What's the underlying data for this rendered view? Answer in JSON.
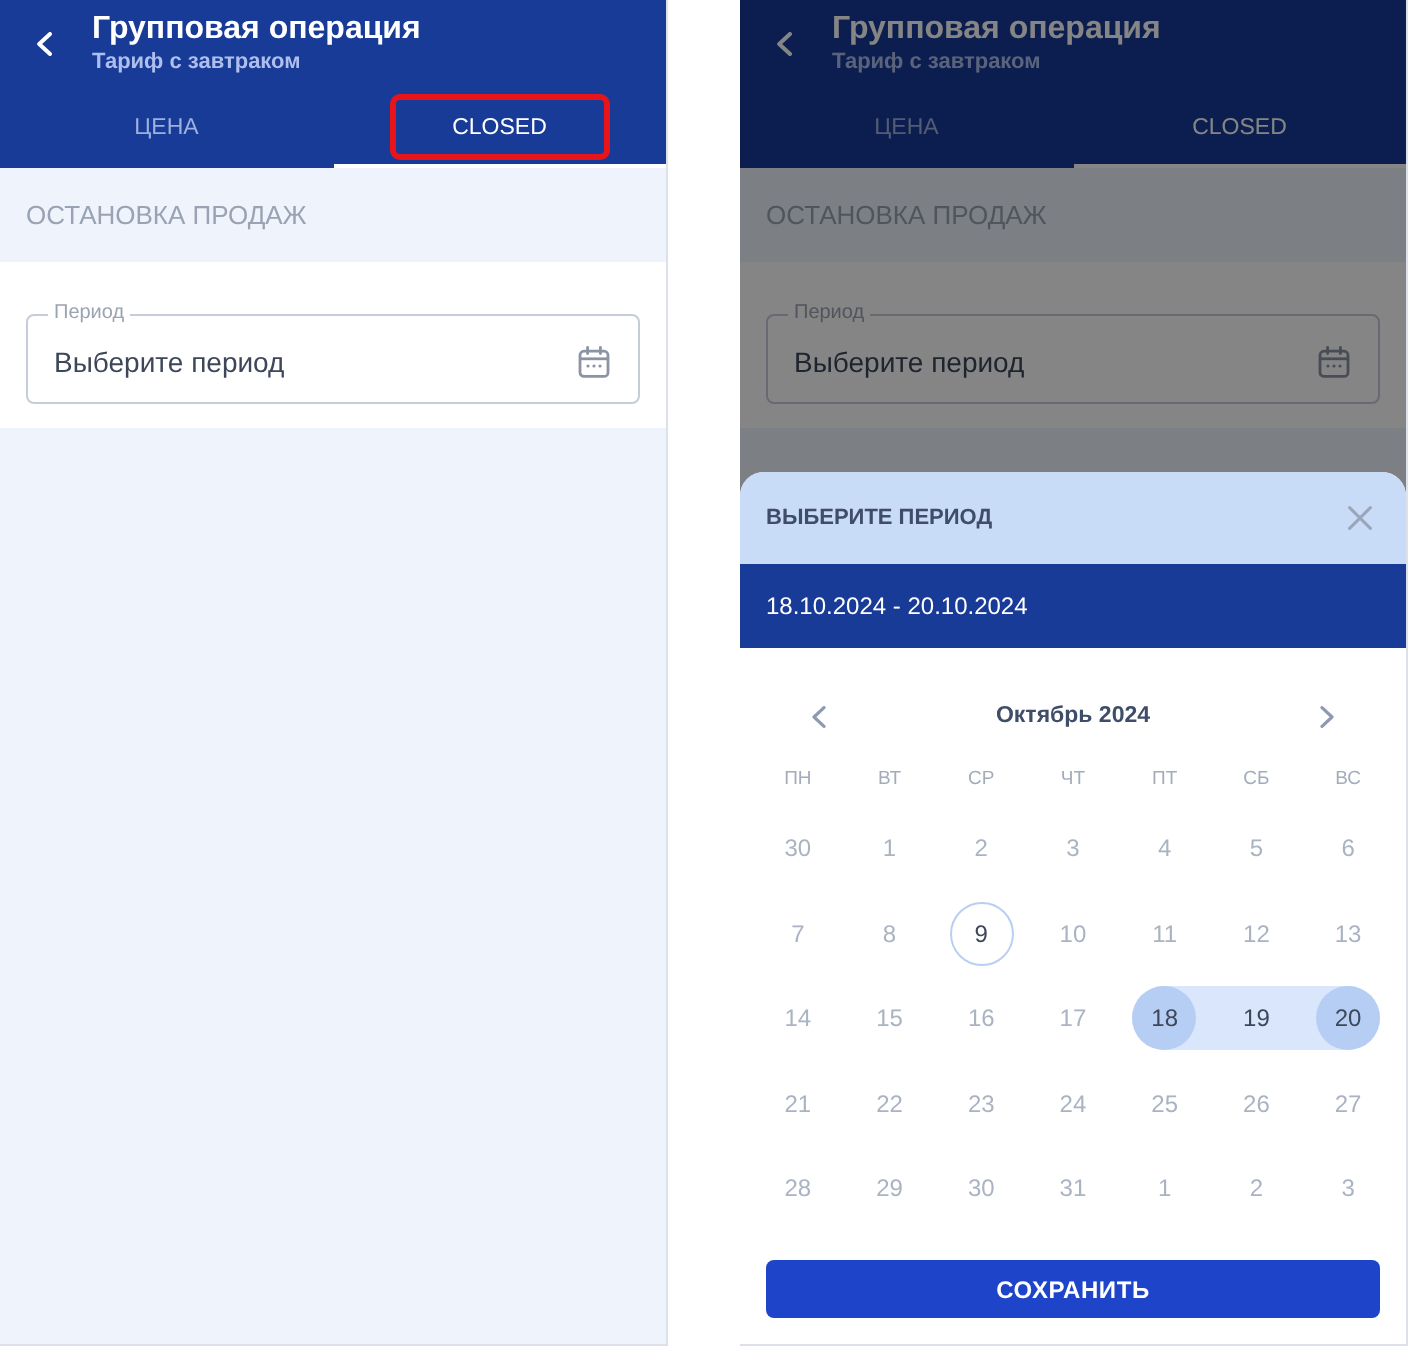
{
  "screens": [
    {
      "header": {
        "title": "Групповая операция",
        "subtitle": "Тариф с завтраком"
      },
      "tabs": [
        {
          "label": "ЦЕНА",
          "selected": false,
          "highlighted": false
        },
        {
          "label": "CLOSED",
          "selected": true,
          "highlighted": true
        }
      ],
      "section_title": "ОСТАНОВКА ПРОДАЖ",
      "period_field": {
        "label": "Период",
        "placeholder": "Выберите период"
      }
    },
    {
      "header": {
        "title": "Групповая операция",
        "subtitle": "Тариф с завтраком"
      },
      "tabs": [
        {
          "label": "ЦЕНА",
          "selected": false,
          "highlighted": false
        },
        {
          "label": "CLOSED",
          "selected": true,
          "highlighted": false
        }
      ],
      "section_title": "ОСТАНОВКА ПРОДАЖ",
      "period_field": {
        "label": "Период",
        "placeholder": "Выберите период"
      },
      "date_sheet": {
        "title": "ВЫБЕРИТЕ ПЕРИОД",
        "range": "18.10.2024 - 20.10.2024",
        "month": "Октябрь 2024",
        "weekdays": [
          "ПН",
          "ВТ",
          "СР",
          "ЧТ",
          "ПТ",
          "СБ",
          "ВС"
        ],
        "weeks": [
          {
            "days": [
              {
                "label": "30",
                "selected": false,
                "in_range": false,
                "today": false
              },
              {
                "label": "1",
                "selected": false,
                "in_range": false,
                "today": false
              },
              {
                "label": "2",
                "selected": false,
                "in_range": false,
                "today": false
              },
              {
                "label": "3",
                "selected": false,
                "in_range": false,
                "today": false
              },
              {
                "label": "4",
                "selected": false,
                "in_range": false,
                "today": false
              },
              {
                "label": "5",
                "selected": false,
                "in_range": false,
                "today": false
              },
              {
                "label": "6",
                "selected": false,
                "in_range": false,
                "today": false
              }
            ]
          },
          {
            "days": [
              {
                "label": "7",
                "selected": false,
                "in_range": false,
                "today": false
              },
              {
                "label": "8",
                "selected": false,
                "in_range": false,
                "today": false
              },
              {
                "label": "9",
                "selected": false,
                "in_range": false,
                "today": true
              },
              {
                "label": "10",
                "selected": false,
                "in_range": false,
                "today": false
              },
              {
                "label": "11",
                "selected": false,
                "in_range": false,
                "today": false
              },
              {
                "label": "12",
                "selected": false,
                "in_range": false,
                "today": false
              },
              {
                "label": "13",
                "selected": false,
                "in_range": false,
                "today": false
              }
            ]
          },
          {
            "days": [
              {
                "label": "14",
                "selected": false,
                "in_range": false,
                "today": false
              },
              {
                "label": "15",
                "selected": false,
                "in_range": false,
                "today": false
              },
              {
                "label": "16",
                "selected": false,
                "in_range": false,
                "today": false
              },
              {
                "label": "17",
                "selected": false,
                "in_range": false,
                "today": false
              },
              {
                "label": "18",
                "selected": true,
                "in_range": true,
                "today": false
              },
              {
                "label": "19",
                "selected": false,
                "in_range": true,
                "today": false
              },
              {
                "label": "20",
                "selected": true,
                "in_range": true,
                "today": false
              }
            ]
          },
          {
            "days": [
              {
                "label": "21",
                "selected": false,
                "in_range": false,
                "today": false
              },
              {
                "label": "22",
                "selected": false,
                "in_range": false,
                "today": false
              },
              {
                "label": "23",
                "selected": false,
                "in_range": false,
                "today": false
              },
              {
                "label": "24",
                "selected": false,
                "in_range": false,
                "today": false
              },
              {
                "label": "25",
                "selected": false,
                "in_range": false,
                "today": false
              },
              {
                "label": "26",
                "selected": false,
                "in_range": false,
                "today": false
              },
              {
                "label": "27",
                "selected": false,
                "in_range": false,
                "today": false
              }
            ]
          },
          {
            "days": [
              {
                "label": "28",
                "selected": false,
                "in_range": false,
                "today": false
              },
              {
                "label": "29",
                "selected": false,
                "in_range": false,
                "today": false
              },
              {
                "label": "30",
                "selected": false,
                "in_range": false,
                "today": false
              },
              {
                "label": "31",
                "selected": false,
                "in_range": false,
                "today": false
              },
              {
                "label": "1",
                "selected": false,
                "in_range": false,
                "today": false
              },
              {
                "label": "2",
                "selected": false,
                "in_range": false,
                "today": false
              },
              {
                "label": "3",
                "selected": false,
                "in_range": false,
                "today": false
              }
            ]
          }
        ],
        "save_button": "СОХРАНИТЬ"
      }
    }
  ]
}
